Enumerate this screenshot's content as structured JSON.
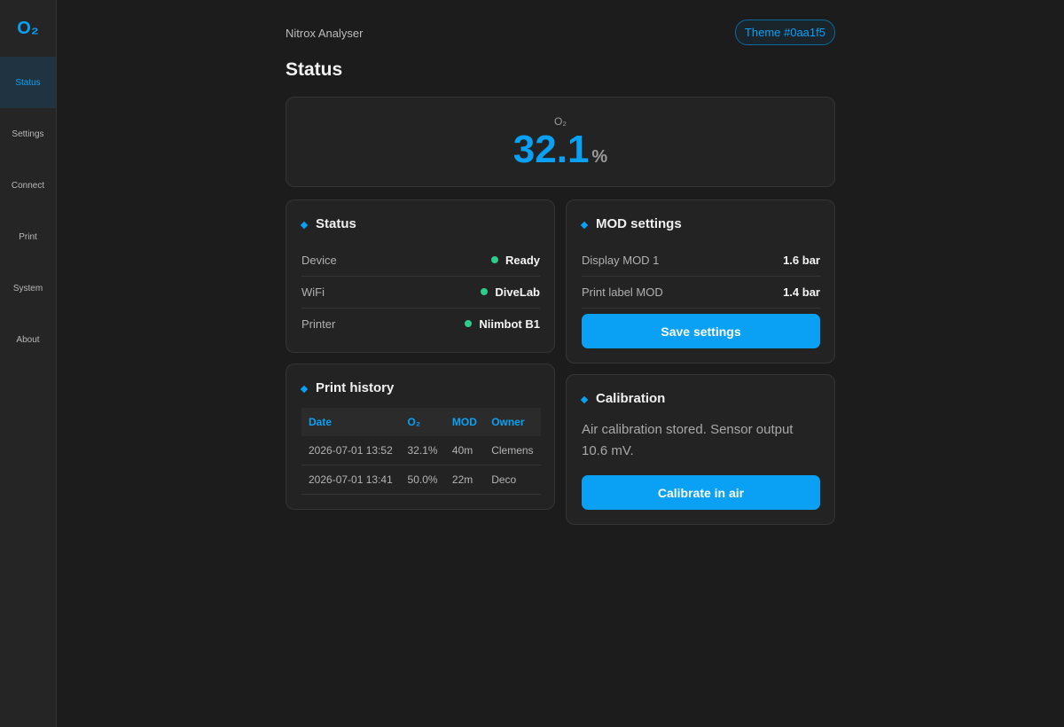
{
  "sidebar": {
    "logo": "O₂",
    "items": [
      {
        "label": "Status",
        "active": true
      },
      {
        "label": "Settings"
      },
      {
        "label": "Connect"
      },
      {
        "label": "Print"
      },
      {
        "label": "System"
      },
      {
        "label": "About"
      }
    ]
  },
  "header": {
    "app_name": "Nitrox Analyser",
    "theme_label": "Theme #0aa1f5",
    "page_title": "Status"
  },
  "reading": {
    "label": "O₂",
    "value": "32.1",
    "unit": "%"
  },
  "status_card": {
    "title": "Status",
    "rows": [
      {
        "label": "Device",
        "value": "Ready"
      },
      {
        "label": "WiFi",
        "value": "DiveLab"
      },
      {
        "label": "Printer",
        "value": "Niimbot B1"
      }
    ]
  },
  "mod_card": {
    "title": "MOD settings",
    "rows": [
      {
        "label": "Display MOD 1",
        "value": "1.6 bar"
      },
      {
        "label": "Print label MOD",
        "value": "1.4 bar"
      }
    ],
    "save_label": "Save settings"
  },
  "history_card": {
    "title": "Print history",
    "columns": [
      "Date",
      "O₂",
      "MOD",
      "Owner"
    ],
    "rows": [
      [
        "2026-07-01 13:52",
        "32.1%",
        "40m",
        "Clemens"
      ],
      [
        "2026-07-01 13:41",
        "50.0%",
        "22m",
        "Deco"
      ]
    ]
  },
  "calibration_card": {
    "title": "Calibration",
    "text": "Air calibration stored. Sensor output 10.6 mV.",
    "button_label": "Calibrate in air"
  },
  "colors": {
    "accent": "#0aa1f5",
    "status_ok": "#2ecc8a",
    "background": "#1c1c1c",
    "card": "#232323"
  }
}
